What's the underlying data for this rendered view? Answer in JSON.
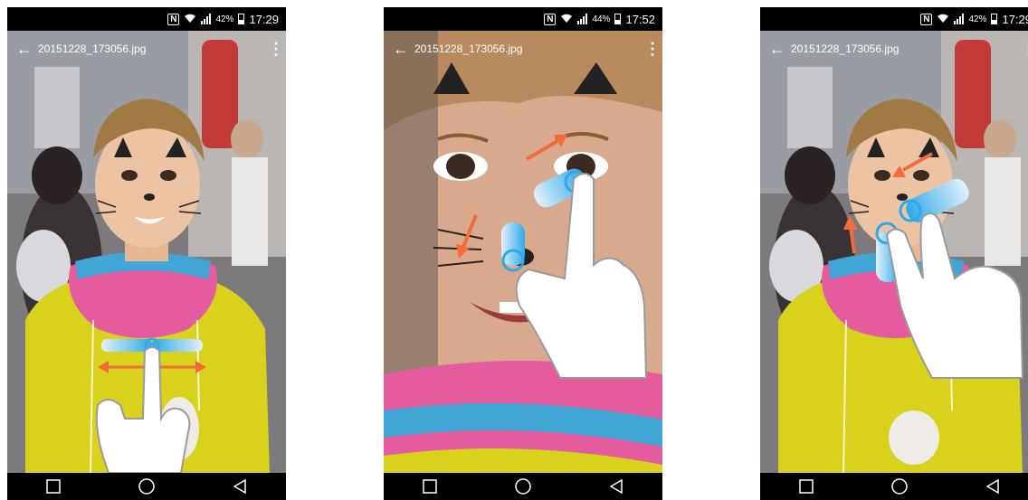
{
  "screens": [
    {
      "status": {
        "nfc": "N",
        "battery_pct": "42%",
        "time": "17:29"
      },
      "file_name": "20151228_173056.jpg",
      "gesture": "swipe-horizontal"
    },
    {
      "status": {
        "nfc": "N",
        "battery_pct": "44%",
        "time": "17:52"
      },
      "file_name": "20151228_173056.jpg",
      "gesture": "pinch-zoom-out"
    },
    {
      "status": {
        "nfc": "N",
        "battery_pct": "42%",
        "time": "17:29"
      },
      "file_name": "20151228_173056.jpg",
      "gesture": "pinch-zoom-in"
    }
  ],
  "icons": {
    "back": "arrow-left-icon",
    "menu": "more-vert-icon",
    "nav_recents": "square-icon",
    "nav_home": "circle-icon",
    "nav_back": "triangle-left-icon"
  },
  "colors": {
    "arrow_orange": "#f26b3a",
    "finger_blue": "#2fa8e8"
  }
}
